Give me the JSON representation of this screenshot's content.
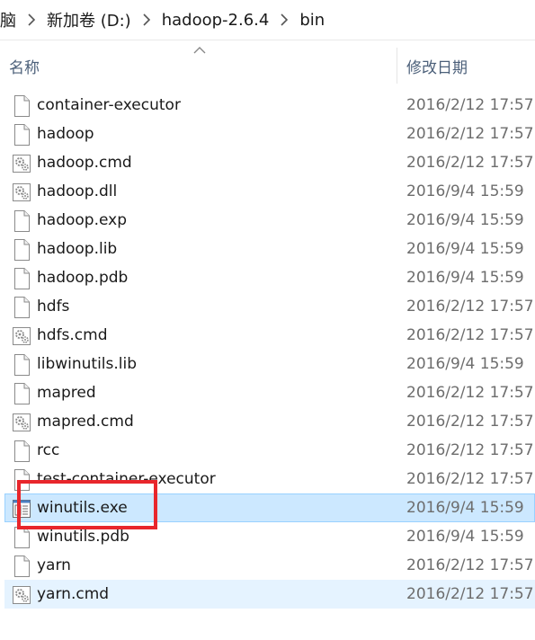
{
  "breadcrumb": {
    "items": [
      "脑",
      "新加卷 (D:)",
      "hadoop-2.6.4",
      "bin"
    ]
  },
  "columns": {
    "name": "名称",
    "date": "修改日期"
  },
  "files": [
    {
      "name": "container-executor",
      "date": "2016/2/12 17:57",
      "icon": "blank-file-icon",
      "state": ""
    },
    {
      "name": "hadoop",
      "date": "2016/2/12 17:57",
      "icon": "blank-file-icon",
      "state": ""
    },
    {
      "name": "hadoop.cmd",
      "date": "2016/2/12 17:57",
      "icon": "gear-file-icon",
      "state": ""
    },
    {
      "name": "hadoop.dll",
      "date": "2016/9/4 15:59",
      "icon": "gear-file-icon",
      "state": ""
    },
    {
      "name": "hadoop.exp",
      "date": "2016/9/4 15:59",
      "icon": "blank-file-icon",
      "state": ""
    },
    {
      "name": "hadoop.lib",
      "date": "2016/9/4 15:59",
      "icon": "blank-file-icon",
      "state": ""
    },
    {
      "name": "hadoop.pdb",
      "date": "2016/9/4 15:59",
      "icon": "blank-file-icon",
      "state": ""
    },
    {
      "name": "hdfs",
      "date": "2016/2/12 17:57",
      "icon": "blank-file-icon",
      "state": ""
    },
    {
      "name": "hdfs.cmd",
      "date": "2016/2/12 17:57",
      "icon": "gear-file-icon",
      "state": ""
    },
    {
      "name": "libwinutils.lib",
      "date": "2016/9/4 15:59",
      "icon": "blank-file-icon",
      "state": ""
    },
    {
      "name": "mapred",
      "date": "2016/2/12 17:57",
      "icon": "blank-file-icon",
      "state": ""
    },
    {
      "name": "mapred.cmd",
      "date": "2016/2/12 17:57",
      "icon": "gear-file-icon",
      "state": ""
    },
    {
      "name": "rcc",
      "date": "2016/2/12 17:57",
      "icon": "blank-file-icon",
      "state": ""
    },
    {
      "name": "test-container-executor",
      "date": "2016/2/12 17:57",
      "icon": "blank-file-icon",
      "state": ""
    },
    {
      "name": "winutils.exe",
      "date": "2016/9/4 15:59",
      "icon": "exe-file-icon",
      "state": "selected"
    },
    {
      "name": "winutils.pdb",
      "date": "2016/9/4 15:59",
      "icon": "blank-file-icon",
      "state": ""
    },
    {
      "name": "yarn",
      "date": "2016/2/12 17:57",
      "icon": "blank-file-icon",
      "state": ""
    },
    {
      "name": "yarn.cmd",
      "date": "2016/2/12 17:57",
      "icon": "gear-file-icon",
      "state": "hover"
    }
  ],
  "colors": {
    "selected_bg": "#cce8ff",
    "hover_bg": "#e5f3ff",
    "highlight": "#e8262c"
  }
}
